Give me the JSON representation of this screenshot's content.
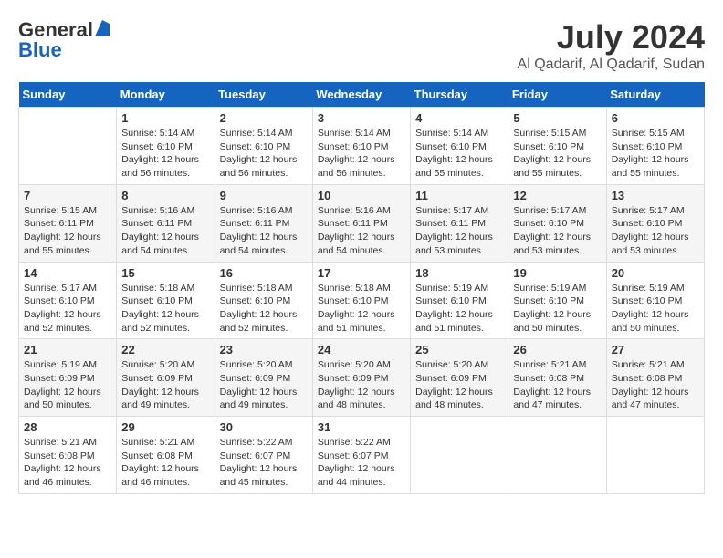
{
  "header": {
    "logo_general": "General",
    "logo_blue": "Blue",
    "month": "July 2024",
    "location": "Al Qadarif, Al Qadarif, Sudan"
  },
  "weekdays": [
    "Sunday",
    "Monday",
    "Tuesday",
    "Wednesday",
    "Thursday",
    "Friday",
    "Saturday"
  ],
  "weeks": [
    [
      {
        "num": "",
        "detail": ""
      },
      {
        "num": "1",
        "detail": "Sunrise: 5:14 AM\nSunset: 6:10 PM\nDaylight: 12 hours\nand 56 minutes."
      },
      {
        "num": "2",
        "detail": "Sunrise: 5:14 AM\nSunset: 6:10 PM\nDaylight: 12 hours\nand 56 minutes."
      },
      {
        "num": "3",
        "detail": "Sunrise: 5:14 AM\nSunset: 6:10 PM\nDaylight: 12 hours\nand 56 minutes."
      },
      {
        "num": "4",
        "detail": "Sunrise: 5:14 AM\nSunset: 6:10 PM\nDaylight: 12 hours\nand 55 minutes."
      },
      {
        "num": "5",
        "detail": "Sunrise: 5:15 AM\nSunset: 6:10 PM\nDaylight: 12 hours\nand 55 minutes."
      },
      {
        "num": "6",
        "detail": "Sunrise: 5:15 AM\nSunset: 6:10 PM\nDaylight: 12 hours\nand 55 minutes."
      }
    ],
    [
      {
        "num": "7",
        "detail": "Sunrise: 5:15 AM\nSunset: 6:11 PM\nDaylight: 12 hours\nand 55 minutes."
      },
      {
        "num": "8",
        "detail": "Sunrise: 5:16 AM\nSunset: 6:11 PM\nDaylight: 12 hours\nand 54 minutes."
      },
      {
        "num": "9",
        "detail": "Sunrise: 5:16 AM\nSunset: 6:11 PM\nDaylight: 12 hours\nand 54 minutes."
      },
      {
        "num": "10",
        "detail": "Sunrise: 5:16 AM\nSunset: 6:11 PM\nDaylight: 12 hours\nand 54 minutes."
      },
      {
        "num": "11",
        "detail": "Sunrise: 5:17 AM\nSunset: 6:11 PM\nDaylight: 12 hours\nand 53 minutes."
      },
      {
        "num": "12",
        "detail": "Sunrise: 5:17 AM\nSunset: 6:10 PM\nDaylight: 12 hours\nand 53 minutes."
      },
      {
        "num": "13",
        "detail": "Sunrise: 5:17 AM\nSunset: 6:10 PM\nDaylight: 12 hours\nand 53 minutes."
      }
    ],
    [
      {
        "num": "14",
        "detail": "Sunrise: 5:17 AM\nSunset: 6:10 PM\nDaylight: 12 hours\nand 52 minutes."
      },
      {
        "num": "15",
        "detail": "Sunrise: 5:18 AM\nSunset: 6:10 PM\nDaylight: 12 hours\nand 52 minutes."
      },
      {
        "num": "16",
        "detail": "Sunrise: 5:18 AM\nSunset: 6:10 PM\nDaylight: 12 hours\nand 52 minutes."
      },
      {
        "num": "17",
        "detail": "Sunrise: 5:18 AM\nSunset: 6:10 PM\nDaylight: 12 hours\nand 51 minutes."
      },
      {
        "num": "18",
        "detail": "Sunrise: 5:19 AM\nSunset: 6:10 PM\nDaylight: 12 hours\nand 51 minutes."
      },
      {
        "num": "19",
        "detail": "Sunrise: 5:19 AM\nSunset: 6:10 PM\nDaylight: 12 hours\nand 50 minutes."
      },
      {
        "num": "20",
        "detail": "Sunrise: 5:19 AM\nSunset: 6:10 PM\nDaylight: 12 hours\nand 50 minutes."
      }
    ],
    [
      {
        "num": "21",
        "detail": "Sunrise: 5:19 AM\nSunset: 6:09 PM\nDaylight: 12 hours\nand 50 minutes."
      },
      {
        "num": "22",
        "detail": "Sunrise: 5:20 AM\nSunset: 6:09 PM\nDaylight: 12 hours\nand 49 minutes."
      },
      {
        "num": "23",
        "detail": "Sunrise: 5:20 AM\nSunset: 6:09 PM\nDaylight: 12 hours\nand 49 minutes."
      },
      {
        "num": "24",
        "detail": "Sunrise: 5:20 AM\nSunset: 6:09 PM\nDaylight: 12 hours\nand 48 minutes."
      },
      {
        "num": "25",
        "detail": "Sunrise: 5:20 AM\nSunset: 6:09 PM\nDaylight: 12 hours\nand 48 minutes."
      },
      {
        "num": "26",
        "detail": "Sunrise: 5:21 AM\nSunset: 6:08 PM\nDaylight: 12 hours\nand 47 minutes."
      },
      {
        "num": "27",
        "detail": "Sunrise: 5:21 AM\nSunset: 6:08 PM\nDaylight: 12 hours\nand 47 minutes."
      }
    ],
    [
      {
        "num": "28",
        "detail": "Sunrise: 5:21 AM\nSunset: 6:08 PM\nDaylight: 12 hours\nand 46 minutes."
      },
      {
        "num": "29",
        "detail": "Sunrise: 5:21 AM\nSunset: 6:08 PM\nDaylight: 12 hours\nand 46 minutes."
      },
      {
        "num": "30",
        "detail": "Sunrise: 5:22 AM\nSunset: 6:07 PM\nDaylight: 12 hours\nand 45 minutes."
      },
      {
        "num": "31",
        "detail": "Sunrise: 5:22 AM\nSunset: 6:07 PM\nDaylight: 12 hours\nand 44 minutes."
      },
      {
        "num": "",
        "detail": ""
      },
      {
        "num": "",
        "detail": ""
      },
      {
        "num": "",
        "detail": ""
      }
    ]
  ]
}
